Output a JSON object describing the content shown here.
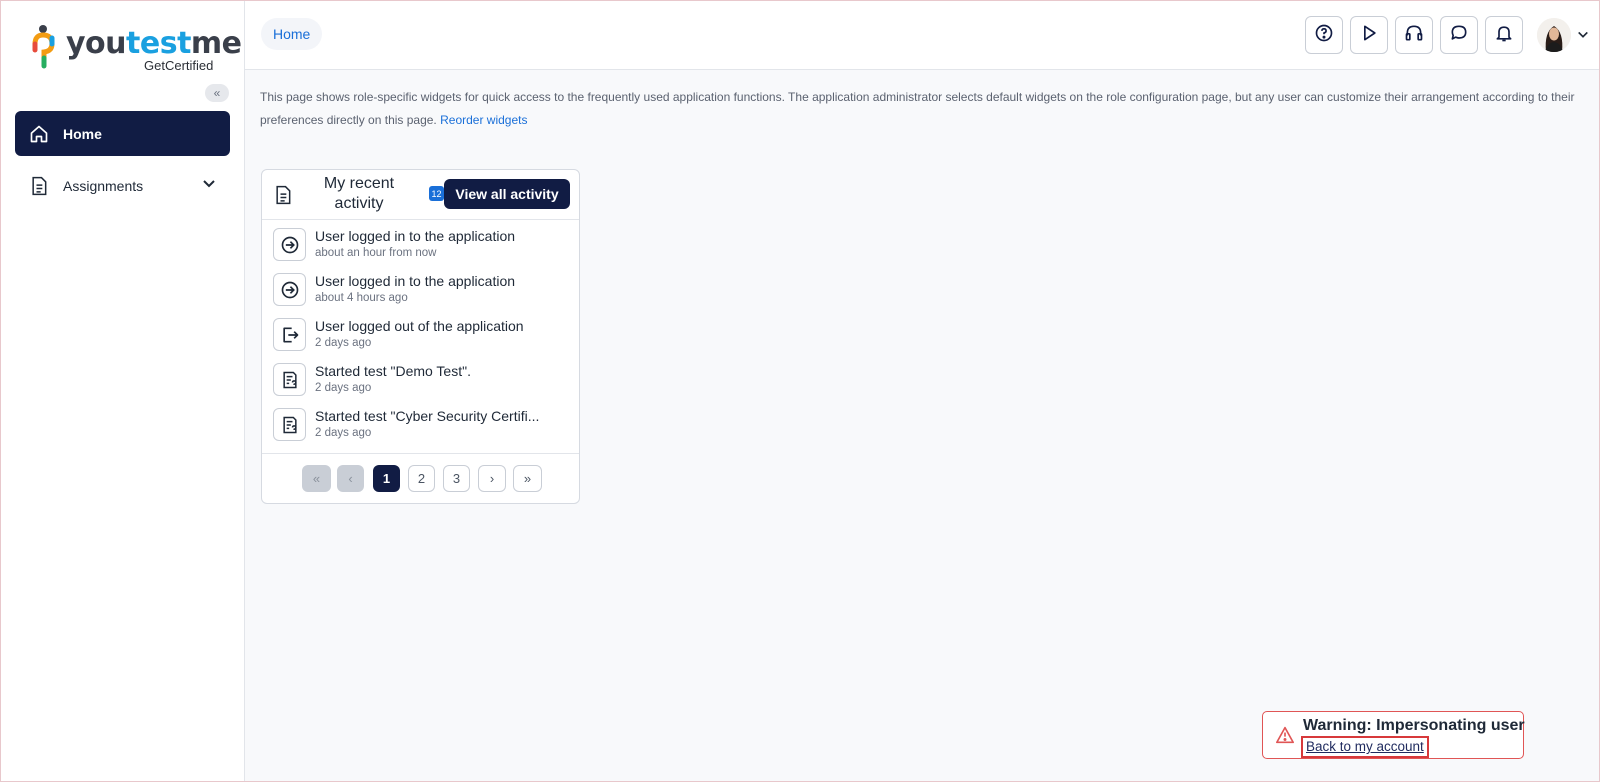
{
  "brand": {
    "logo_part1": "you",
    "logo_part2": "test",
    "logo_part3": "me",
    "tagline": "GetCertified"
  },
  "sidebar": {
    "collapse_icon": "double-chevron-left",
    "items": [
      {
        "label": "Home",
        "icon": "home-icon",
        "active": true
      },
      {
        "label": "Assignments",
        "icon": "document-icon",
        "expandable": true
      }
    ]
  },
  "header": {
    "breadcrumb": "Home",
    "buttons": [
      "help-icon",
      "play-icon",
      "headset-icon",
      "chat-icon",
      "bell-icon"
    ]
  },
  "intro": {
    "text": "This page shows role-specific widgets for quick access to the frequently used application functions. The application administrator selects default widgets on the role configuration page, but any user can customize their arrangement according to their preferences directly on this page.",
    "link": "Reorder widgets"
  },
  "widget": {
    "title": "My recent activity",
    "badge": "12",
    "view_all": "View all activity",
    "activities": [
      {
        "title": "User logged in to the application",
        "time": "about an hour from now",
        "icon": "login-icon"
      },
      {
        "title": "User logged in to the application",
        "time": "about 4 hours ago",
        "icon": "login-icon"
      },
      {
        "title": "User logged out of the application",
        "time": "2 days ago",
        "icon": "logout-icon"
      },
      {
        "title": "Started test \"Demo Test\".",
        "time": "2 days ago",
        "icon": "test-icon"
      },
      {
        "title": "Started test \"Cyber Security Certifi...",
        "time": "2 days ago",
        "icon": "test-icon"
      }
    ],
    "pagination": {
      "first": "«",
      "prev": "‹",
      "pages": [
        "1",
        "2",
        "3"
      ],
      "current": "1",
      "next": "›",
      "last": "»"
    }
  },
  "warning": {
    "text": "Warning: Impersonating user",
    "link": "Back to my account",
    "color": "#e05555"
  },
  "colors": {
    "primary_dark": "#111c44",
    "link_blue": "#1a6fd8"
  }
}
